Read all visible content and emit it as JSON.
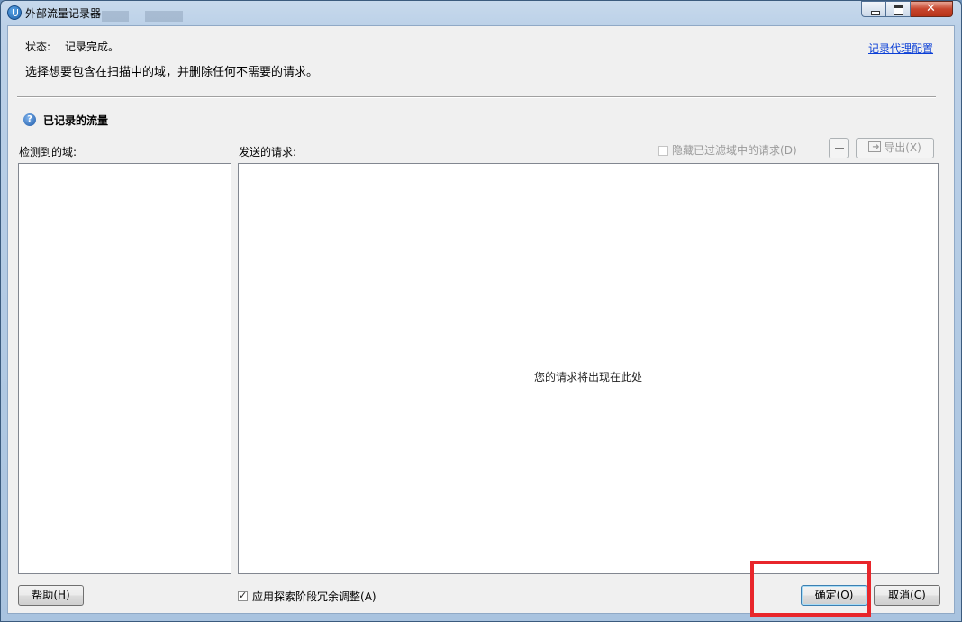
{
  "window": {
    "title": "外部流量记录器"
  },
  "header": {
    "status_label": "状态:",
    "status_value": "记录完成。",
    "instruction": "选择想要包含在扫描中的域，并删除任何不需要的请求。",
    "proxy_link": "记录代理配置"
  },
  "section": {
    "help_icon": "?",
    "title": "已记录的流量"
  },
  "domains": {
    "label": "检测到的域:"
  },
  "requests": {
    "label": "发送的请求:",
    "hide_filtered_label": "隐藏已过滤域中的请求",
    "hide_filtered_hotkey": "(D)",
    "export_label": "导出",
    "export_hotkey": "(X)",
    "placeholder": "您的请求将出现在此处"
  },
  "footer": {
    "help_button": "帮助",
    "help_hotkey": "(H)",
    "apply_redundant_label": "应用探索阶段冗余调整",
    "apply_redundant_hotkey": "(A)",
    "apply_redundant_checked": true,
    "ok_button": "确定",
    "ok_hotkey": "(O)",
    "cancel_button": "取消",
    "cancel_hotkey": "(C)"
  },
  "colors": {
    "highlight_box": "#e8262b",
    "link": "#0b3fd6"
  }
}
